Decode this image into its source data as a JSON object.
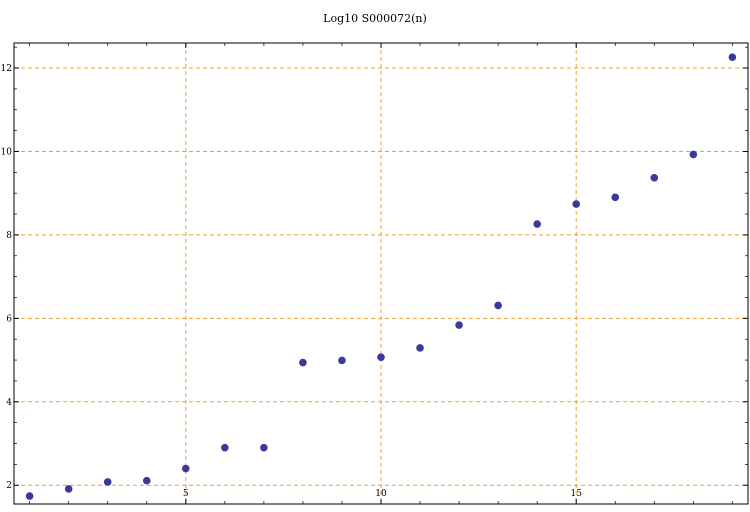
{
  "chart_data": {
    "type": "scatter",
    "title": "Log10 S000072(n)",
    "xlabel": "",
    "ylabel": "",
    "xlim": [
      0.6,
      19.4
    ],
    "ylim": [
      1.55,
      12.6
    ],
    "x_ticks": [
      5,
      10,
      15
    ],
    "y_ticks": [
      2,
      4,
      6,
      8,
      10,
      12
    ],
    "grid": true,
    "colors": {
      "points": "#3a3a9a",
      "grid": "#f0a030",
      "frame": "#000000"
    },
    "series": [
      {
        "x": [
          1,
          2,
          3,
          4,
          5,
          6,
          7,
          8,
          9,
          10,
          11,
          12,
          13,
          14,
          15,
          16,
          17,
          18,
          19
        ],
        "y": [
          1.74,
          1.91,
          2.08,
          2.11,
          2.4,
          2.9,
          2.9,
          4.94,
          4.99,
          5.07,
          5.29,
          5.84,
          6.31,
          8.26,
          8.74,
          8.9,
          9.37,
          9.93,
          12.26
        ]
      }
    ]
  }
}
